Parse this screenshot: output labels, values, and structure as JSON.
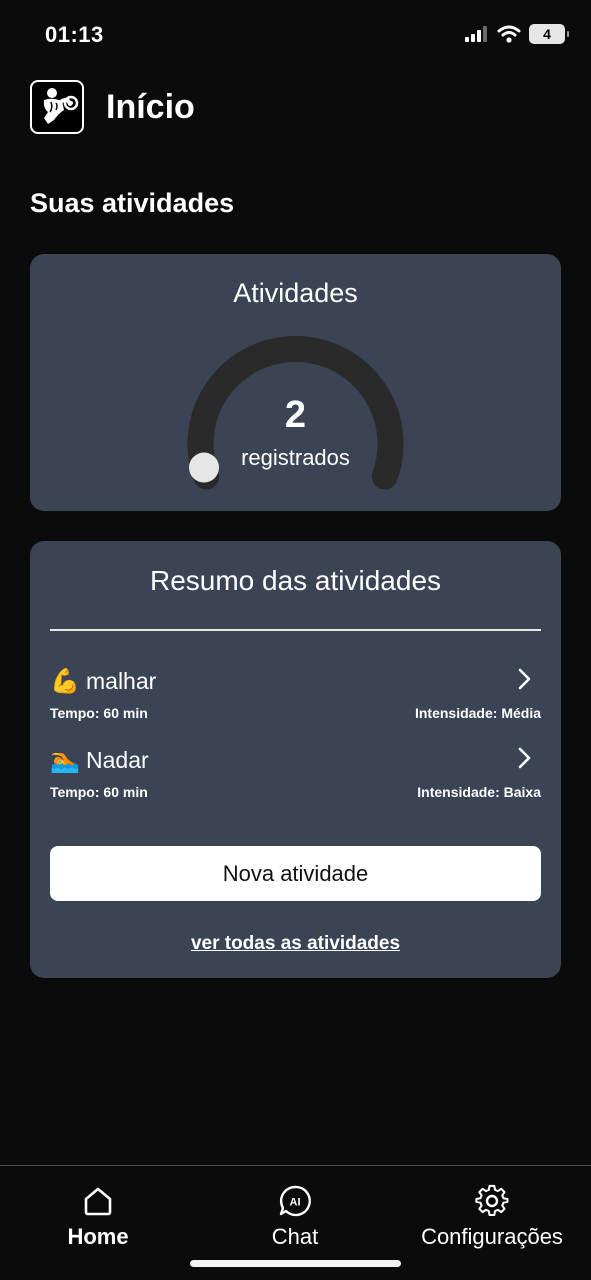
{
  "status_bar": {
    "time": "01:13",
    "battery_level": "4"
  },
  "header": {
    "title": "Início",
    "logo_icon": "bodybuilder-icon"
  },
  "section_title": "Suas atividades",
  "activities_card": {
    "title": "Atividades",
    "count": "2",
    "count_label": "registrados",
    "gauge_progress": 0.02,
    "track_color": "#2a2a2a",
    "thumb_color": "#e6e6e6"
  },
  "summary_card": {
    "title": "Resumo das atividades",
    "items": [
      {
        "emoji_icon": "flexed-biceps-icon",
        "emoji": "💪",
        "name": "malhar",
        "time": "Tempo: 60 min",
        "intensity": "Intensidade: Média"
      },
      {
        "emoji_icon": "swimmer-icon",
        "emoji": "🏊",
        "name": "Nadar",
        "time": "Tempo: 60 min",
        "intensity": "Intensidade: Baixa"
      }
    ],
    "new_button": "Nova atividade",
    "see_all": "ver todas as atividades"
  },
  "tabbar": {
    "tabs": [
      {
        "label": "Home",
        "icon": "home-icon",
        "active": true
      },
      {
        "label": "Chat",
        "icon": "ai-chat-icon",
        "active": false
      },
      {
        "label": "Configurações",
        "icon": "gear-icon",
        "active": false
      }
    ]
  },
  "colors": {
    "background": "#0b0b0b",
    "card": "#3a4455",
    "text": "#ffffff"
  }
}
